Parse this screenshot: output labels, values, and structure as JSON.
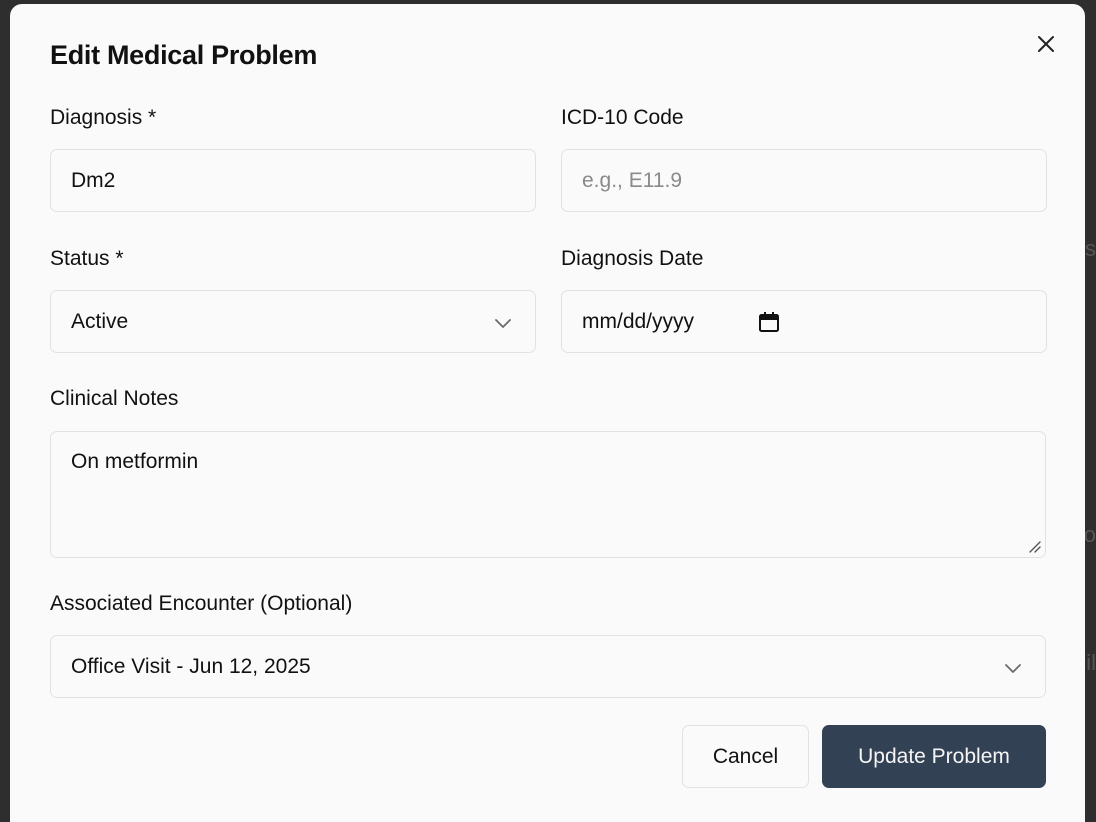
{
  "dialog": {
    "title": "Edit Medical Problem"
  },
  "form": {
    "diagnosis": {
      "label": "Diagnosis *",
      "value": "Dm2"
    },
    "icd10": {
      "label": "ICD-10 Code",
      "value": "",
      "placeholder": "e.g., E11.9"
    },
    "status": {
      "label": "Status *",
      "selected": "Active"
    },
    "diagnosis_date": {
      "label": "Diagnosis Date",
      "placeholder": "mm/dd/yyyy"
    },
    "notes": {
      "label": "Clinical Notes",
      "value": "On metformin"
    },
    "encounter": {
      "label": "Associated Encounter (Optional)",
      "selected": "Office Visit - Jun 12, 2025"
    }
  },
  "actions": {
    "cancel_label": "Cancel",
    "submit_label": "Update Problem"
  },
  "icons": {
    "close": "close-icon",
    "status_chevron": "chevron-down-icon",
    "encounter_chevron": "chevron-down-icon",
    "date_picker": "calendar-icon",
    "textarea_resize": "resize-handle-icon"
  },
  "colors": {
    "primary_button": "#334155",
    "backdrop": "#2e2e2e",
    "modal_background": "#fafafa",
    "border": "#e2e2e2"
  }
}
